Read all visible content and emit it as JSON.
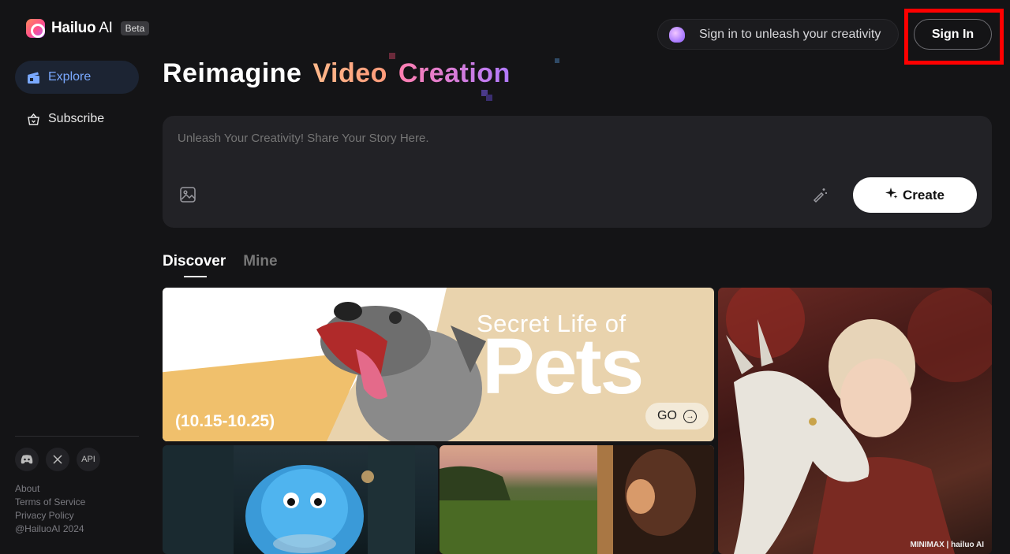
{
  "app": {
    "name_bold": "Hailuo",
    "name_light": " AI",
    "badge": "Beta"
  },
  "sidebar": {
    "items": [
      {
        "label": "Explore",
        "icon": "clapperboard-icon",
        "active": true
      },
      {
        "label": "Subscribe",
        "icon": "crown-basket-icon",
        "active": false
      }
    ],
    "social": [
      {
        "icon": "discord-icon"
      },
      {
        "icon": "x-logo-icon"
      },
      {
        "icon": "api-icon",
        "label": "API"
      }
    ],
    "footer": [
      "About",
      "Terms of Service",
      "Privacy Policy",
      "@HailuoAI 2024"
    ]
  },
  "header": {
    "promo_text": "Sign in to unleash your creativity",
    "signin_label": "Sign In"
  },
  "hero": {
    "word1": "Reimagine",
    "word2": "Video",
    "word3": "Creation"
  },
  "prompt": {
    "placeholder": "Unleash Your Creativity! Share Your Story Here.",
    "create_label": "Create"
  },
  "tabs": [
    {
      "label": "Discover",
      "active": true
    },
    {
      "label": "Mine",
      "active": false
    }
  ],
  "banner": {
    "title_small": "Secret Life of",
    "title_big": "Pets",
    "dates": "(10.15-10.25)",
    "go_label": "GO"
  },
  "cards": {
    "watermark": "MINIMAX | hailuo AI"
  },
  "colors": {
    "accent_blue": "#7aa9ff",
    "highlight_red": "#ff0000"
  }
}
